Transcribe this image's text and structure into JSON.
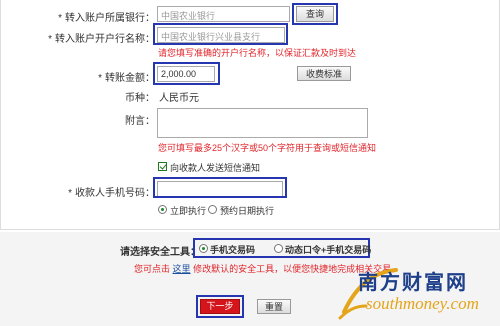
{
  "form": {
    "bank_label": "转入账户所属银行：",
    "bank_value": "中国农业银行",
    "query_button": "查询",
    "branch_label": "转入账户开户行名称：",
    "branch_value": "中国农业银行兴业县支行",
    "branch_hint": "请您填写准确的开户行名称，以保证汇款及时到达",
    "amount_label": "转账金额：",
    "amount_value": "2,000.00",
    "fee_button": "收费标准",
    "currency_label": "币种：",
    "currency_value": "人民币元",
    "note_label": "附言：",
    "note_hint": "您可填写最多25个汉字或50个字符用于查询或短信通知",
    "sms_notify_label": "向收款人发送短信通知",
    "phone_label": "收款人手机号码：",
    "exec_now": "立即执行",
    "exec_scheduled": "预约日期执行"
  },
  "security": {
    "title": "请选择安全工具：",
    "option1": "手机交易码",
    "option2": "动态口令+手机交易码",
    "hint_prefix": "您可点击",
    "hint_link": "这里",
    "hint_suffix": "修改默认的安全工具，以便您快捷地完成相关交易。"
  },
  "actions": {
    "next": "下一步",
    "reset": "重置"
  },
  "watermark": {
    "cn": "南方财富网",
    "en": "southmoney.com"
  },
  "colors": {
    "highlight": "#2636b0",
    "red": "#e0252b",
    "next_button": "#d4151c"
  }
}
